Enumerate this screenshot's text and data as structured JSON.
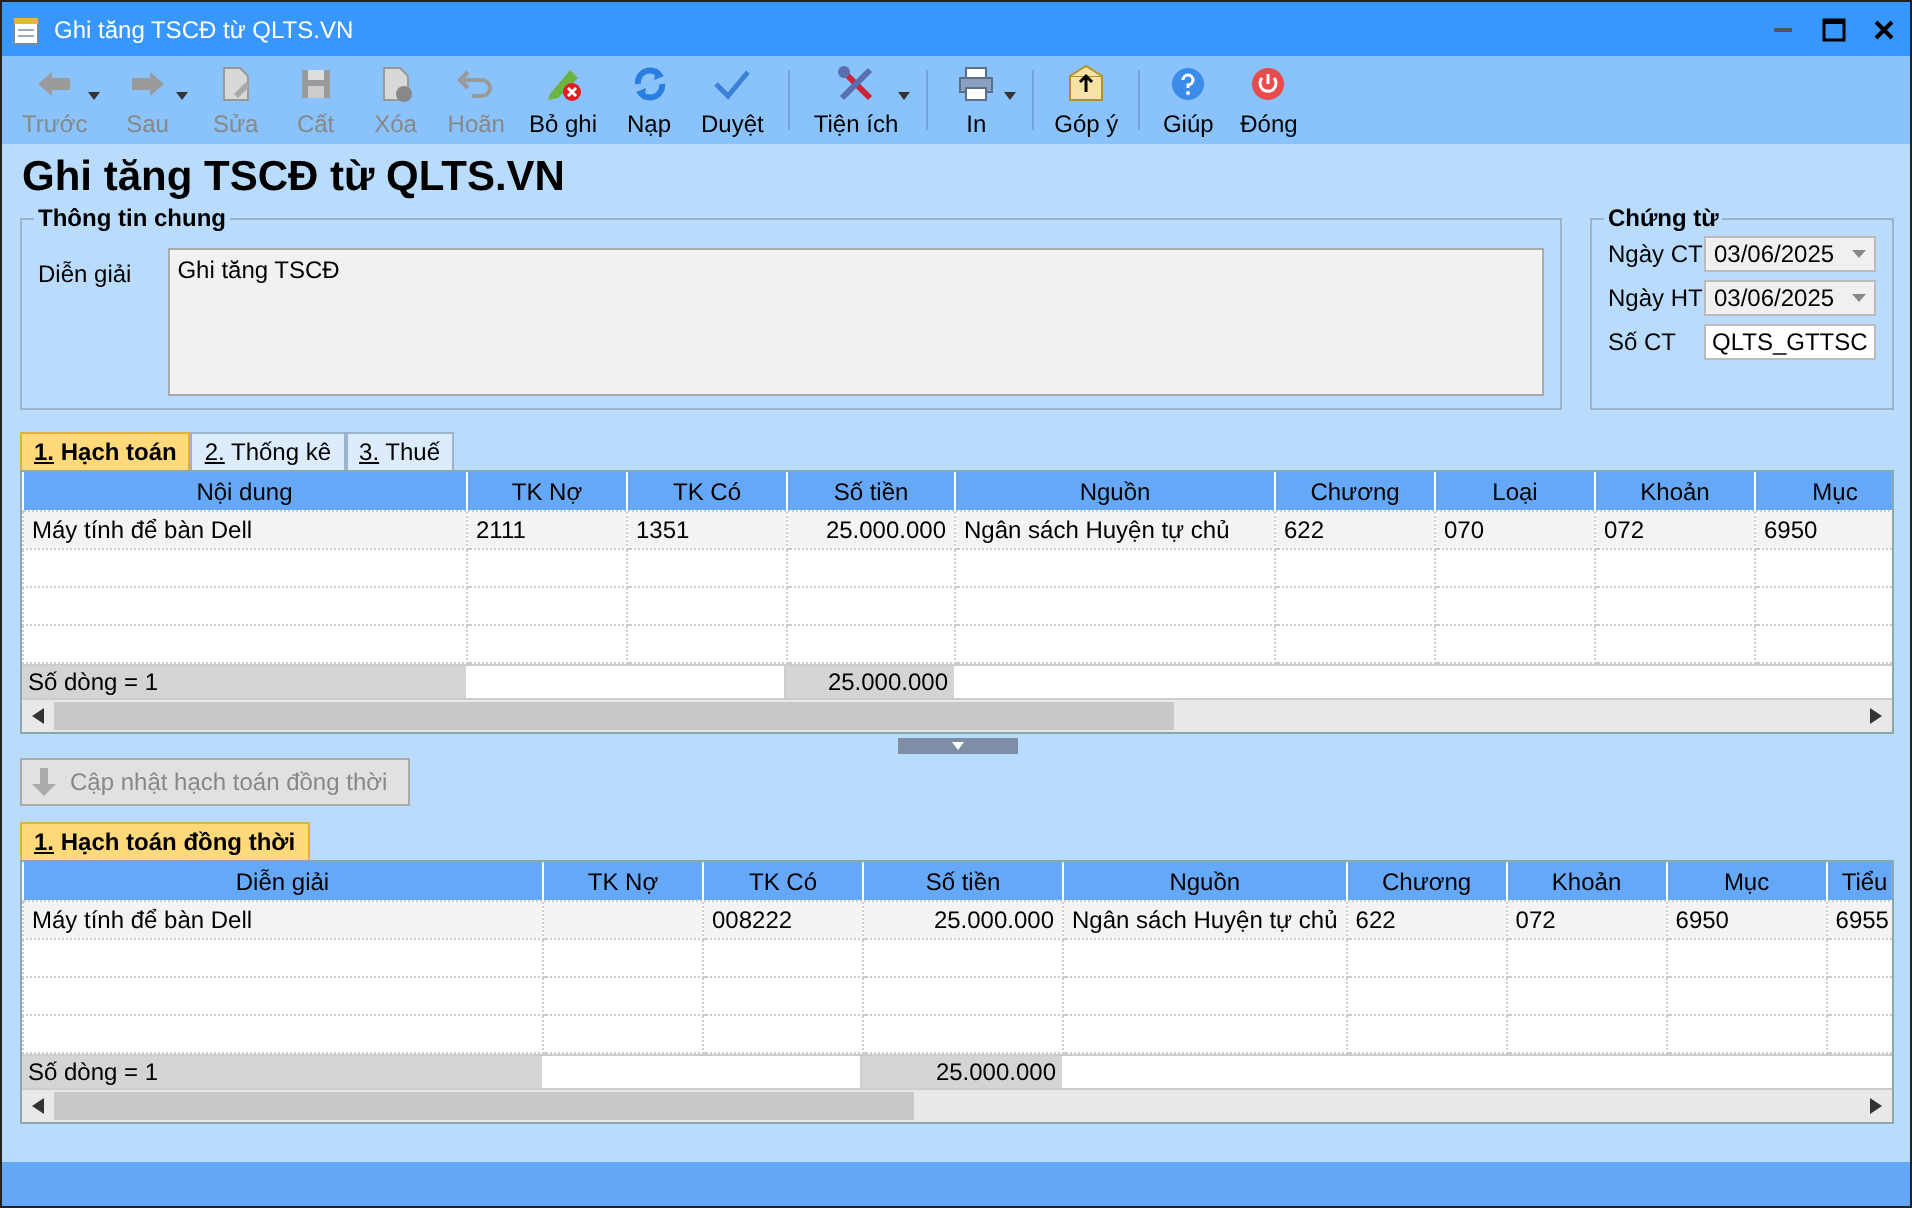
{
  "window": {
    "title": "Ghi tăng TSCĐ từ QLTS.VN"
  },
  "toolbar": [
    [
      {
        "label": "Trước",
        "disabled": true,
        "dropdown": true
      },
      {
        "label": "Sau",
        "disabled": true,
        "dropdown": true
      },
      {
        "label": "Sửa",
        "disabled": true,
        "dropdown": false
      },
      {
        "label": "Cất",
        "disabled": true,
        "dropdown": false
      },
      {
        "label": "Xóa",
        "disabled": true,
        "dropdown": false
      },
      {
        "label": "Hoãn",
        "disabled": true,
        "dropdown": false
      },
      {
        "label": "Bỏ ghi",
        "disabled": false,
        "dropdown": false
      },
      {
        "label": "Nạp",
        "disabled": false,
        "dropdown": false
      },
      {
        "label": "Duyệt",
        "disabled": false,
        "dropdown": false
      }
    ],
    [
      {
        "label": "Tiện ích",
        "disabled": false,
        "dropdown": true
      }
    ],
    [
      {
        "label": "In",
        "disabled": false,
        "dropdown": true
      }
    ],
    [
      {
        "label": "Góp ý",
        "disabled": false,
        "dropdown": false
      }
    ],
    [
      {
        "label": "Giúp",
        "disabled": false,
        "dropdown": false
      },
      {
        "label": "Đóng",
        "disabled": false,
        "dropdown": false
      }
    ]
  ],
  "heading": "Ghi tăng TSCĐ từ QLTS.VN",
  "general": {
    "title": "Thông tin chung",
    "label": "Diễn giải",
    "value": "Ghi tăng TSCĐ"
  },
  "voucher": {
    "title": "Chứng từ",
    "fields": [
      {
        "label": "Ngày CT",
        "value": "03/06/2025",
        "kind": "date"
      },
      {
        "label": "Ngày HT",
        "value": "03/06/2025",
        "kind": "date"
      },
      {
        "label": "Số CT",
        "value": "QLTS_GTTSC",
        "kind": "text"
      }
    ]
  },
  "tabs": [
    {
      "label": "1. Hạch toán",
      "selected": true
    },
    {
      "label": "2. Thống kê",
      "selected": false
    },
    {
      "label": "3. Thuế",
      "selected": false
    }
  ],
  "table": {
    "columns": [
      "Nội dung",
      "TK Nợ",
      "TK Có",
      "Số tiền",
      "Nguồn",
      "Chương",
      "Loại",
      "Khoản",
      "Mục"
    ],
    "rows": [
      [
        "Máy tính để bàn Dell",
        "2111",
        "1351",
        "25.000.000",
        "Ngân sách Huyện tự chủ",
        "622",
        "070",
        "072",
        "6950"
      ]
    ],
    "footer": {
      "count": "Số dòng = 1",
      "total": "25.000.000"
    }
  },
  "update_button": {
    "label": "Cập nhật hạch toán đồng thời",
    "disabled": true
  },
  "tabs2": [
    {
      "label": "1. Hạch toán đồng thời",
      "selected": true
    }
  ],
  "table2": {
    "columns": [
      "Diễn giải",
      "TK Nợ",
      "TK Có",
      "Số tiền",
      "Nguồn",
      "Chương",
      "Khoản",
      "Mục",
      "Tiểu"
    ],
    "rows": [
      [
        "Máy tính để bàn Dell",
        "",
        "008222",
        "25.000.000",
        "Ngân sách Huyện tự chủ",
        "622",
        "072",
        "6950",
        "6955"
      ]
    ],
    "footer": {
      "count": "Số dòng = 1",
      "total": "25.000.000"
    }
  }
}
